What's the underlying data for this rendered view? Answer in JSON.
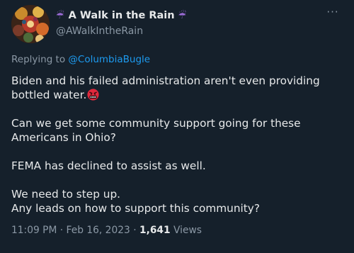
{
  "author": {
    "display_name": "A Walk in the Rain",
    "handle": "@AWalkIntheRain",
    "name_prefix_emoji": "☔",
    "name_suffix_emoji": "☔"
  },
  "more_icon": "more-horizontal-icon",
  "reply": {
    "prefix": "Replying to",
    "target": "@ColumbiaBugle"
  },
  "tweet": {
    "line1": "Biden and his failed administration aren't even providing",
    "line2": "bottled water.",
    "line2_emoji": "angry-face-with-symbols-emoji",
    "line3": "Can we get some community support going for these",
    "line4": "Americans in Ohio?",
    "line5": "FEMA has declined to assist as well.",
    "line6": "We need to step up.",
    "line7": "Any leads on how to support this community?"
  },
  "meta": {
    "time": "11:09 PM",
    "sep1": " · ",
    "date": "Feb 16, 2023",
    "sep2": " · ",
    "views_count": "1,641",
    "views_label": " Views"
  },
  "colors": {
    "background": "#15202b",
    "primary_text": "#e7e9ea",
    "secondary_text": "#8b98a5",
    "link": "#1d9bf0",
    "umbrella": "#9b6bd6"
  }
}
